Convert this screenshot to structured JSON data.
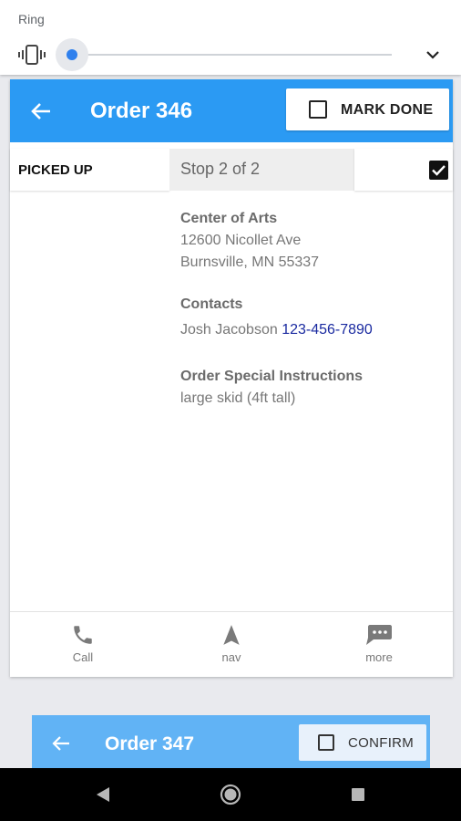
{
  "volume": {
    "label": "Ring",
    "level": 0.0,
    "icons": {
      "mode": "vibrate-icon",
      "expand": "chevron-down-icon"
    }
  },
  "order": {
    "title": "Order 346",
    "mark_done_label": "MARK DONE",
    "status_label": "PICKED UP",
    "stop_label": "Stop 2 of 2",
    "checked": true,
    "location": {
      "name": "Center of Arts",
      "address1": "12600 Nicollet Ave",
      "address2": "Burnsville, MN 55337"
    },
    "contacts": {
      "heading": "Contacts",
      "name": "Josh Jacobson",
      "phone": "123-456-7890"
    },
    "instructions": {
      "heading": "Order Special Instructions",
      "text": "large skid (4ft tall)"
    },
    "actions": [
      {
        "label": "Call",
        "icon": "phone-icon"
      },
      {
        "label": "nav",
        "icon": "navigation-arrow-icon"
      },
      {
        "label": "more",
        "icon": "more-message-icon"
      }
    ]
  },
  "next_order": {
    "title": "Order 347",
    "confirm_label": "CONFIRM"
  },
  "colors": {
    "header_blue": "#2b9af3",
    "header_blue_faded": "#61b3f5",
    "phone_link": "#1a2aa0",
    "slider_accent": "#2f80ed"
  }
}
